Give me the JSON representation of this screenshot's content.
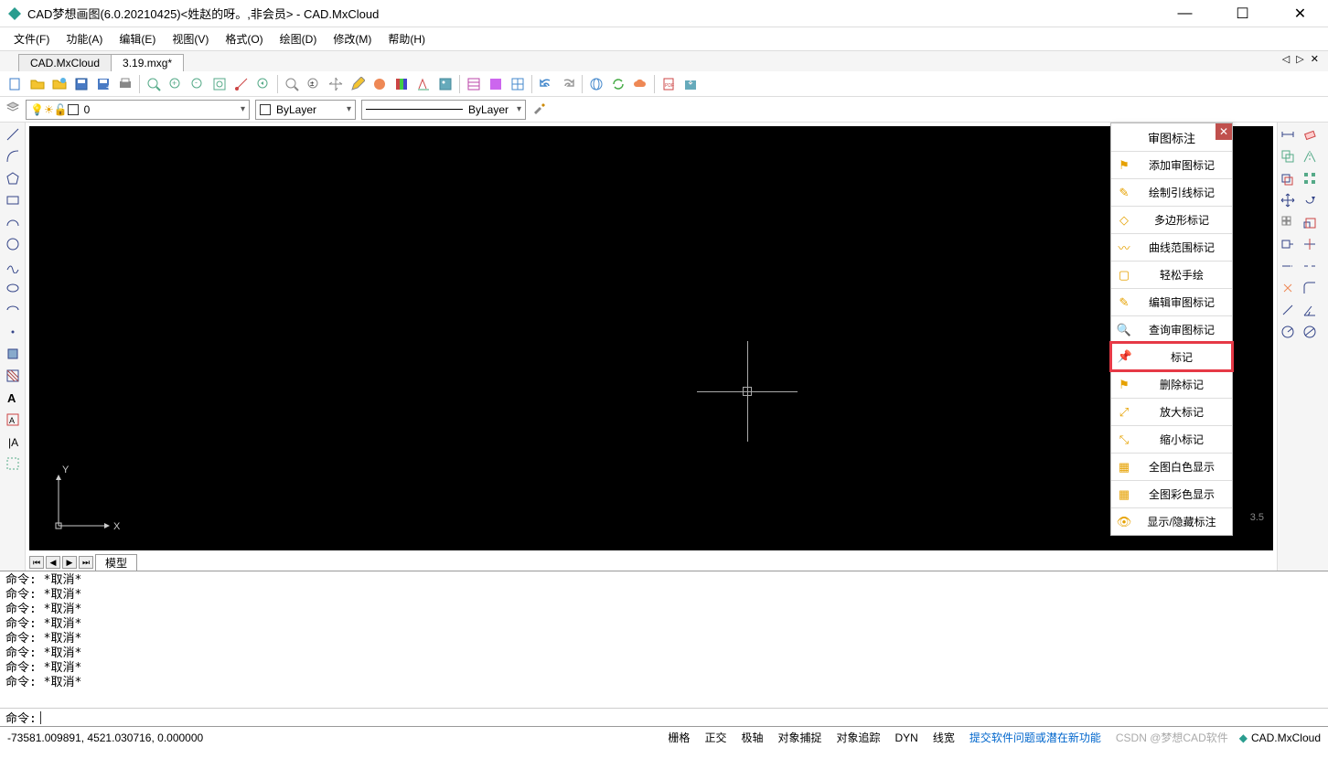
{
  "window": {
    "title": "CAD梦想画图(6.0.20210425)<姓赵的呀。,非会员> - CAD.MxCloud"
  },
  "menus": [
    "文件(F)",
    "功能(A)",
    "编辑(E)",
    "视图(V)",
    "格式(O)",
    "绘图(D)",
    "修改(M)",
    "帮助(H)"
  ],
  "tabs": {
    "items": [
      "CAD.MxCloud",
      "3.19.mxg*"
    ],
    "active": 1,
    "ctrl": "◁ ▷ ✕"
  },
  "props": {
    "layer": "0",
    "color": "ByLayer",
    "linetype": "ByLayer"
  },
  "panel": {
    "title": "审图标注",
    "items": [
      {
        "icon": "⚑",
        "label": "添加审图标记"
      },
      {
        "icon": "✎",
        "label": "绘制引线标记"
      },
      {
        "icon": "◇",
        "label": "多边形标记"
      },
      {
        "icon": "〰",
        "label": "曲线范围标记"
      },
      {
        "icon": "▢",
        "label": "轻松手绘"
      },
      {
        "icon": "✎",
        "label": "编辑审图标记"
      },
      {
        "icon": "🔍",
        "label": "查询审图标记"
      },
      {
        "icon": "📌",
        "label": "标记",
        "highlight": true
      },
      {
        "icon": "⚑",
        "label": "删除标记"
      },
      {
        "icon": "⤢",
        "label": "放大标记"
      },
      {
        "icon": "⤡",
        "label": "缩小标记"
      },
      {
        "icon": "▦",
        "label": "全图白色显示"
      },
      {
        "icon": "▦",
        "label": "全图彩色显示"
      },
      {
        "icon": "👁",
        "label": "显示/隐藏标注"
      }
    ]
  },
  "model_tab": "模型",
  "scale": "3.5",
  "cmdlog": [
    "命令:  *取消*",
    "命令:  *取消*",
    "命令:  *取消*",
    "命令:  *取消*",
    "命令:  *取消*",
    "命令:  *取消*",
    "命令:  *取消*",
    "命令:  *取消*"
  ],
  "cmd_prompt": "命令:",
  "status": {
    "coords": "-73581.009891,  4521.030716,  0.000000",
    "toggles": [
      "栅格",
      "正交",
      "极轴",
      "对象捕捉",
      "对象追踪",
      "DYN",
      "线宽"
    ],
    "link": "提交软件问题或潜在新功能",
    "watermark": "CSDN @梦想CAD软件",
    "brand": "CAD.MxCloud"
  }
}
